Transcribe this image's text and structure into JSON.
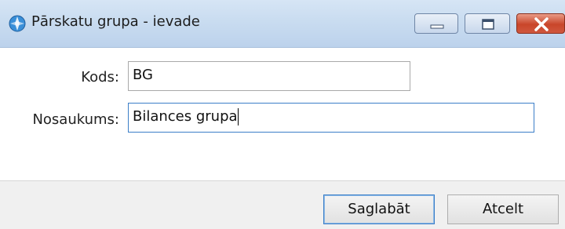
{
  "window": {
    "title": "Pārskatu grupa - ievade",
    "icon": "app-globe-icon",
    "controls": {
      "minimize_icon": "minimize-icon",
      "maximize_icon": "maximize-icon",
      "close_icon": "close-icon"
    }
  },
  "form": {
    "kods_label": "Kods:",
    "kods_value": "BG",
    "nosaukums_label": "Nosaukums:",
    "nosaukums_value": "Bilances grupa"
  },
  "buttons": {
    "save_label": "Saglabāt",
    "cancel_label": "Atcelt"
  },
  "colors": {
    "titlebar": "#c9dcf0",
    "close_button": "#c9452a",
    "focus_border": "#3c7fc8"
  }
}
